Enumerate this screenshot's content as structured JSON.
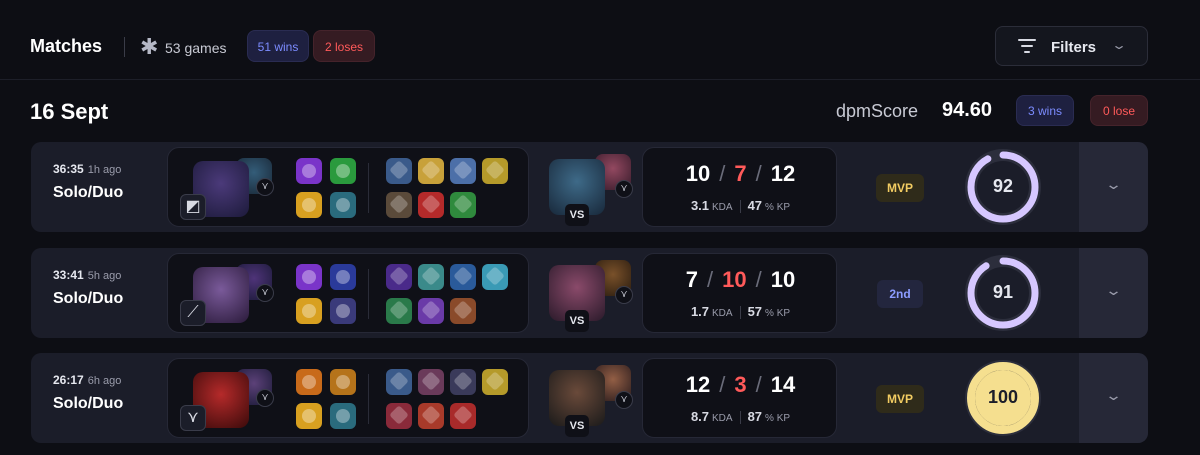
{
  "header": {
    "title": "Matches",
    "games_icon": "asterisk-icon",
    "games": "53 games",
    "wins": "51 wins",
    "loses": "2 loses",
    "filters_label": "Filters",
    "filters_icon": "filter-lines-icon"
  },
  "day": {
    "date": "16 Sept",
    "dpm_label": "dpmScore",
    "dpm_value": "94.60",
    "wins": "3 wins",
    "lose": "0 lose"
  },
  "colors": {
    "win_text": "#7c8cff",
    "lose_text": "#ff5a5a",
    "mvp_gold": "#f2cc62",
    "score_ring": "#d6c7ff",
    "score_ring_perfect": "#f5df8f"
  },
  "matches": [
    {
      "duration": "36:35",
      "ago": "1h ago",
      "queue": "Solo/Duo",
      "kills": "10",
      "deaths": "7",
      "assists": "12",
      "kda": "3.1",
      "kda_unit": "KDA",
      "kp": "47",
      "kp_unit": "% KP",
      "rank": "MVP",
      "score": "92",
      "score_fraction": 0.92,
      "vs": "VS",
      "role_icon": "role-top-icon",
      "champ_level_icon": "level-badge-icon",
      "spells": [
        "#7a34c9",
        "#2a9a3d",
        "#d8a020",
        "#2a6b7d"
      ],
      "items": [
        "#3a5a8a",
        "#c8a13a",
        "#4c6fa8",
        "#b59a2a",
        "#5a4a3a",
        "#b52a2a",
        "#2f8a3d"
      ],
      "champ_color": [
        "#4b3a7a",
        "#1c1a3a"
      ],
      "mate_color": [
        "#3a6a8a",
        "#1a2a3a"
      ],
      "opp_color": [
        "#3e6a88",
        "#18283a"
      ],
      "opp_mate_color": [
        "#a8506a",
        "#3a1a2a"
      ]
    },
    {
      "duration": "33:41",
      "ago": "5h ago",
      "queue": "Solo/Duo",
      "kills": "7",
      "deaths": "10",
      "assists": "10",
      "kda": "1.7",
      "kda_unit": "KDA",
      "kp": "57",
      "kp_unit": "% KP",
      "rank": "2nd",
      "score": "91",
      "score_fraction": 0.91,
      "vs": "VS",
      "role_icon": "role-mid-icon",
      "champ_level_icon": "level-badge-icon",
      "spells": [
        "#7a34c9",
        "#2a3a9a",
        "#d8a020",
        "#3a3a7a"
      ],
      "items": [
        "#4a2a8a",
        "#3a8a8a",
        "#2a5a9a",
        "#3a9ab5",
        "#2a7a4a",
        "#6a3aa8",
        "#8a4a2a"
      ],
      "champ_color": [
        "#7a5a9a",
        "#2a1a3a"
      ],
      "mate_color": [
        "#5a3a8a",
        "#1a1a3a"
      ],
      "opp_color": [
        "#8a4a6a",
        "#2a1a2a"
      ],
      "opp_mate_color": [
        "#8a5a2a",
        "#2a1a0a"
      ]
    },
    {
      "duration": "26:17",
      "ago": "6h ago",
      "queue": "Solo/Duo",
      "kills": "12",
      "deaths": "3",
      "assists": "14",
      "kda": "8.7",
      "kda_unit": "KDA",
      "kp": "87",
      "kp_unit": "% KP",
      "rank": "MVP",
      "score": "100",
      "score_fraction": 1.0,
      "vs": "VS",
      "role_icon": "role-jungle-icon",
      "champ_level_icon": "level-badge-icon",
      "spells": [
        "#c86a1a",
        "#b5731a",
        "#d8a020",
        "#2a6b7d"
      ],
      "items": [
        "#3a5a8a",
        "#6a3a5a",
        "#3a3a5a",
        "#b59a2a",
        "#8a2a3a",
        "#a83a2a",
        "#a82a2a"
      ],
      "champ_color": [
        "#b52a2a",
        "#3a0a0a"
      ],
      "mate_color": [
        "#6a4a8a",
        "#1a1a3a"
      ],
      "opp_color": [
        "#6a4a3a",
        "#1a1a1a"
      ],
      "opp_mate_color": [
        "#a86a4a",
        "#2a1a1a"
      ]
    }
  ]
}
